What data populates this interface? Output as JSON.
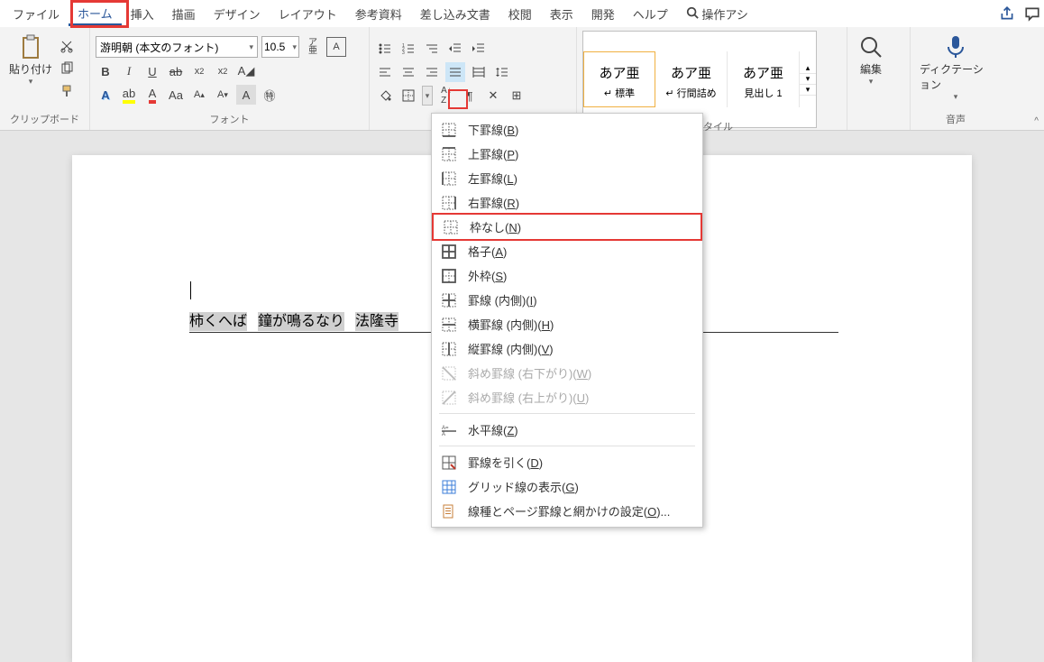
{
  "menu": {
    "tabs": [
      "ファイル",
      "ホーム",
      "挿入",
      "描画",
      "デザイン",
      "レイアウト",
      "参考資料",
      "差し込み文書",
      "校閲",
      "表示",
      "開発",
      "ヘルプ"
    ],
    "search_label": "操作アシ",
    "active_index": 1
  },
  "ribbon": {
    "clipboard": {
      "label": "クリップボード",
      "paste": "貼り付け"
    },
    "font": {
      "label": "フォント",
      "name": "游明朝 (本文のフォント)",
      "size": "10.5"
    },
    "styles": {
      "label_partial": "タイル",
      "items": [
        {
          "preview": "あア亜",
          "name": "↵ 標準"
        },
        {
          "preview": "あア亜",
          "name": "↵ 行間詰め"
        },
        {
          "preview": "あア亜",
          "name": "見出し 1"
        }
      ]
    },
    "editing": {
      "label": "編集"
    },
    "voice": {
      "label": "音声",
      "dictation": "ディクテーション"
    }
  },
  "document": {
    "text_segments": [
      "柿くへば",
      "鐘が鳴るなり",
      "法隆寺"
    ]
  },
  "borders_menu": {
    "items": [
      {
        "label": "下罫線",
        "key": "B",
        "icon": "border-bottom"
      },
      {
        "label": "上罫線",
        "key": "P",
        "icon": "border-top"
      },
      {
        "label": "左罫線",
        "key": "L",
        "icon": "border-left"
      },
      {
        "label": "右罫線",
        "key": "R",
        "icon": "border-right"
      },
      {
        "label": "枠なし",
        "key": "N",
        "icon": "border-none",
        "highlight": true
      },
      {
        "label": "格子",
        "key": "A",
        "icon": "border-all"
      },
      {
        "label": "外枠",
        "key": "S",
        "icon": "border-outside"
      },
      {
        "label": "罫線 (内側)",
        "key": "I",
        "icon": "border-inside"
      },
      {
        "label": "横罫線 (内側)",
        "key": "H",
        "icon": "border-inside-h"
      },
      {
        "label": "縦罫線 (内側)",
        "key": "V",
        "icon": "border-inside-v"
      },
      {
        "label": "斜め罫線 (右下がり)",
        "key": "W",
        "icon": "border-diag-down",
        "disabled": true
      },
      {
        "label": "斜め罫線 (右上がり)",
        "key": "U",
        "icon": "border-diag-up",
        "disabled": true
      },
      {
        "sep": true
      },
      {
        "label": "水平線",
        "key": "Z",
        "icon": "horizontal-line"
      },
      {
        "sep": true
      },
      {
        "label": "罫線を引く",
        "key": "D",
        "icon": "draw-table"
      },
      {
        "label": "グリッド線の表示",
        "key": "G",
        "icon": "view-gridlines"
      },
      {
        "label": "線種とページ罫線と網かけの設定",
        "key": "O",
        "icon": "borders-shading",
        "ellipsis": true
      }
    ]
  }
}
